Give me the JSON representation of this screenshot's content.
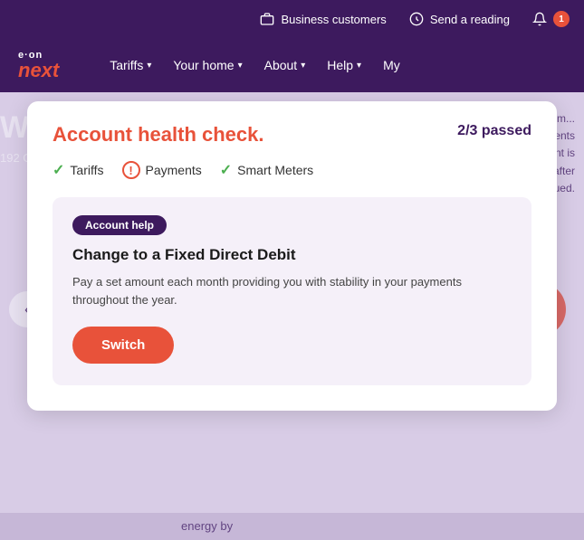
{
  "topBar": {
    "businessCustomers": {
      "label": "Business customers",
      "iconName": "briefcase-icon"
    },
    "sendReading": {
      "label": "Send a reading",
      "iconName": "meter-icon"
    },
    "notification": {
      "count": "1",
      "iconName": "bell-icon"
    }
  },
  "nav": {
    "logo": {
      "eon": "e·on",
      "next": "next"
    },
    "items": [
      {
        "label": "Tariffs",
        "id": "tariffs"
      },
      {
        "label": "Your home",
        "id": "your-home"
      },
      {
        "label": "About",
        "id": "about"
      },
      {
        "label": "Help",
        "id": "help"
      },
      {
        "label": "My",
        "id": "my"
      }
    ]
  },
  "modal": {
    "title": "Account health check.",
    "score": "2/3 passed",
    "checks": [
      {
        "label": "Tariffs",
        "status": "pass"
      },
      {
        "label": "Payments",
        "status": "warning"
      },
      {
        "label": "Smart Meters",
        "status": "pass"
      }
    ],
    "innerCard": {
      "badge": "Account help",
      "title": "Change to a Fixed Direct Debit",
      "description": "Pay a set amount each month providing you with stability in your payments throughout the year.",
      "buttonLabel": "Switch"
    }
  },
  "background": {
    "welcomeText": "W...",
    "addressText": "192 G...",
    "paymentText": "t paym...\npayments\nment is\ns after\nissued.",
    "energyText": "energy by"
  }
}
